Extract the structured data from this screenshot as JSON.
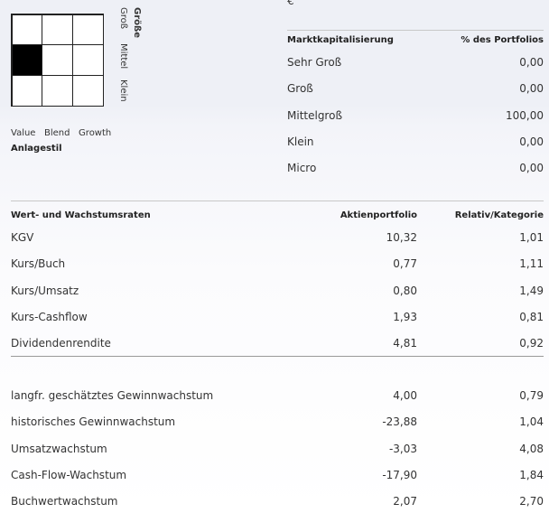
{
  "style_box": {
    "grid": [
      [
        0,
        0,
        0
      ],
      [
        1,
        0,
        0
      ],
      [
        0,
        0,
        0
      ]
    ],
    "size_title": "Größe",
    "size_labels": [
      "Groß",
      "Mittel",
      "Klein"
    ],
    "style_labels": [
      "Value",
      "Blend",
      "Growth"
    ],
    "style_title": "Anlagestil"
  },
  "currency": "€",
  "market_cap": {
    "header": [
      "Marktkapitalisierung",
      "% des Portfolios"
    ],
    "rows": [
      {
        "label": "Sehr Groß",
        "value": "0,00"
      },
      {
        "label": "Groß",
        "value": "0,00"
      },
      {
        "label": "Mittelgroß",
        "value": "100,00"
      },
      {
        "label": "Klein",
        "value": "0,00"
      },
      {
        "label": "Micro",
        "value": "0,00"
      }
    ]
  },
  "valuation": {
    "header": [
      "Wert- und Wachstumsraten",
      "Aktienportfolio",
      "Relativ/Kategorie"
    ],
    "rows": [
      {
        "label": "KGV",
        "portfolio": "10,32",
        "relative": "1,01"
      },
      {
        "label": "Kurs/Buch",
        "portfolio": "0,77",
        "relative": "1,11"
      },
      {
        "label": "Kurs/Umsatz",
        "portfolio": "0,80",
        "relative": "1,49"
      },
      {
        "label": "Kurs-Cashflow",
        "portfolio": "1,93",
        "relative": "0,81"
      },
      {
        "label": "Dividendenrendite",
        "portfolio": "4,81",
        "relative": "0,92"
      }
    ],
    "growth_rows": [
      {
        "label": "langfr. geschätztes Gewinnwachstum",
        "portfolio": "4,00",
        "relative": "0,79"
      },
      {
        "label": "historisches Gewinnwachstum",
        "portfolio": "-23,88",
        "relative": "1,04"
      },
      {
        "label": "Umsatzwachstum",
        "portfolio": "-3,03",
        "relative": "4,08"
      },
      {
        "label": "Cash-Flow-Wachstum",
        "portfolio": "-17,90",
        "relative": "1,84"
      },
      {
        "label": "Buchwertwachstum",
        "portfolio": "2,07",
        "relative": "2,70"
      }
    ]
  }
}
